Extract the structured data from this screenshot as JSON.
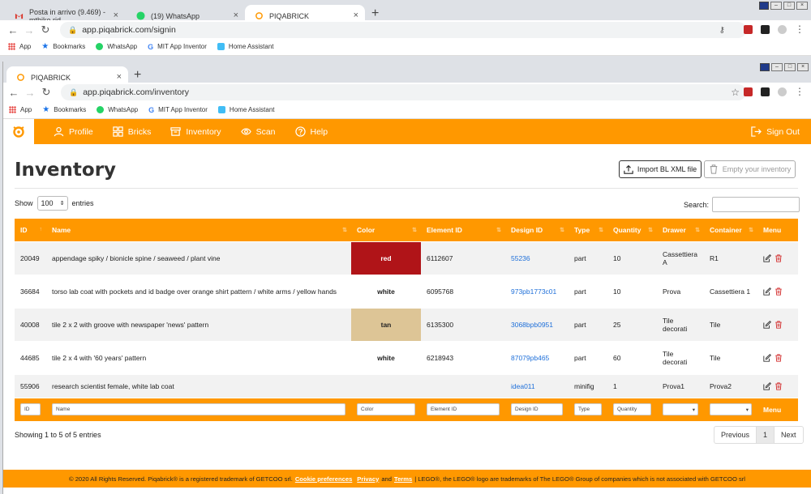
{
  "outer": {
    "tabs": [
      {
        "title": "Posta in arrivo (9.469) - mtbike.rid"
      },
      {
        "title": "(19) WhatsApp"
      },
      {
        "title": "PIQABRICK"
      }
    ],
    "url": "app.piqabrick.com/signin"
  },
  "inner": {
    "tab_title": "PIQABRICK",
    "url": "app.piqabrick.com/inventory"
  },
  "bookmarks": [
    "App",
    "Bookmarks",
    "WhatsApp",
    "MIT App Inventor",
    "Home Assistant"
  ],
  "nav": {
    "items": [
      "Profile",
      "Bricks",
      "Inventory",
      "Scan",
      "Help"
    ],
    "signout": "Sign Out"
  },
  "page": {
    "title": "Inventory",
    "import_label": "Import BL XML file",
    "empty_label": "Empty your inventory",
    "show_label": "Show",
    "show_value": "100",
    "entries_label": "entries",
    "search_label": "Search:",
    "showing": "Showing 1 to 5 of 5 entries",
    "pager": {
      "prev": "Previous",
      "page": "1",
      "next": "Next"
    }
  },
  "table": {
    "headers": [
      "ID",
      "Name",
      "Color",
      "Element ID",
      "Design ID",
      "Type",
      "Quantity",
      "Drawer",
      "Container",
      "Menu"
    ],
    "rows": [
      {
        "id": "20049",
        "name": "appendage spiky / bionicle spine / seaweed / plant vine",
        "color": "red",
        "color_bg": "#b01418",
        "color_fg": "#ffffff",
        "element": "6112607",
        "design": "55236",
        "type": "part",
        "qty": "10",
        "drawer": "Cassettiera A",
        "container": "R1"
      },
      {
        "id": "36684",
        "name": "torso lab coat with pockets and id badge over orange shirt pattern / white arms / yellow hands",
        "color": "white",
        "color_bg": "#ffffff",
        "color_fg": "#222222",
        "element": "6095768",
        "design": "973pb1773c01",
        "type": "part",
        "qty": "10",
        "drawer": "Prova",
        "container": "Cassettiera 1"
      },
      {
        "id": "40008",
        "name": "tile 2 x 2 with groove with newspaper 'news' pattern",
        "color": "tan",
        "color_bg": "#ddc596",
        "color_fg": "#222222",
        "element": "6135300",
        "design": "3068bpb0951",
        "type": "part",
        "qty": "25",
        "drawer": "Tile decorati",
        "container": "Tile"
      },
      {
        "id": "44685",
        "name": "tile 2 x 4 with '60 years' pattern",
        "color": "white",
        "color_bg": "#ffffff",
        "color_fg": "#222222",
        "element": "6218943",
        "design": "87079pb465",
        "type": "part",
        "qty": "60",
        "drawer": "Tile decorati",
        "container": "Tile"
      },
      {
        "id": "55906",
        "name": "research scientist female, white lab coat",
        "color": "",
        "color_bg": "",
        "color_fg": "#222222",
        "element": "",
        "design": "idea011",
        "type": "minifig",
        "qty": "1",
        "drawer": "Prova1",
        "container": "Prova2"
      }
    ],
    "filters": [
      "ID",
      "Name",
      "Color",
      "Element ID",
      "Design ID",
      "Type",
      "Quantity"
    ],
    "filter_menu": "Menu"
  },
  "footer": {
    "text1": "© 2020 All Rights Reserved. Piqabrick® is a registered trademark of GETCOO srl.",
    "cookie": "Cookie preferences",
    "privacy": "Privacy",
    "and": "and",
    "terms": "Terms",
    "text2": "| LEGO®, the LEGO® logo are trademarks of The LEGO® Group of companies which is not associated with GETCOO srl"
  },
  "colors": {
    "accent": "#ff9800",
    "link": "#1e6fd9"
  }
}
